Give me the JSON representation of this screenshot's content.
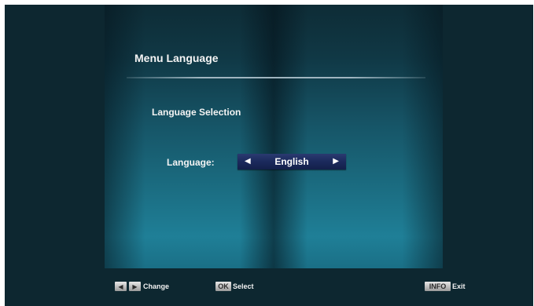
{
  "menu": {
    "title": "Menu Language",
    "section_label": "Language Selection",
    "language_label": "Language:",
    "language_value": "English",
    "prev_arrow": "◀",
    "next_arrow": "▶"
  },
  "footer": {
    "change_keys": [
      "◀",
      "▶"
    ],
    "change_label": "Change",
    "ok_key": "OK",
    "select_label": "Select",
    "info_key": "INFO",
    "exit_label": "Exit"
  },
  "colors": {
    "background": "#0d2730",
    "panel_accent": "#1f7f97",
    "selector": "#1b2a5c",
    "text": "#f4f4f4",
    "key_face": "#bdbdbd"
  }
}
